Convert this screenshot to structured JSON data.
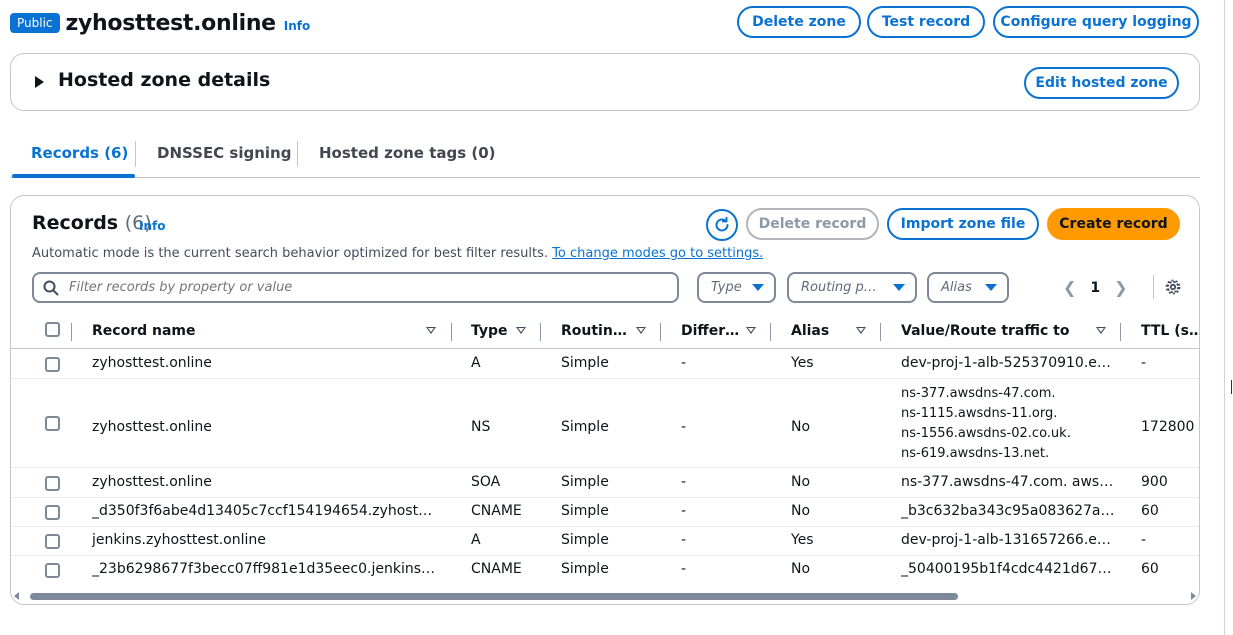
{
  "header": {
    "badge": "Public",
    "zone_name": "zyhosttest.online",
    "info": "Info",
    "buttons": {
      "delete_zone": "Delete zone",
      "test_record": "Test record",
      "configure_query_logging": "Configure query logging"
    }
  },
  "details": {
    "title": "Hosted zone details",
    "edit_button": "Edit hosted zone"
  },
  "tabs": [
    {
      "label": "Records (6)",
      "active": true
    },
    {
      "label": "DNSSEC signing",
      "active": false
    },
    {
      "label": "Hosted zone tags (0)",
      "active": false
    }
  ],
  "records": {
    "title": "Records",
    "count": "(6)",
    "info": "Info",
    "delete_record": "Delete record",
    "import_zone_file": "Import zone file",
    "create_record": "Create record",
    "helper_text": "Automatic mode is the current search behavior optimized for best filter results.",
    "helper_link": "To change modes go to settings.",
    "filter_placeholder": "Filter records by property or value",
    "filters": {
      "type": "Type",
      "routing": "Routing p…",
      "alias": "Alias"
    },
    "page": "1",
    "columns": {
      "record_name": "Record name",
      "type": "Type",
      "routing": "Routin…",
      "differentiator": "Differ…",
      "alias": "Alias",
      "value": "Value/Route traffic to",
      "ttl": "TTL (s…"
    },
    "rows": [
      {
        "name": "zyhosttest.online",
        "type": "A",
        "routing": "Simple",
        "diff": "-",
        "alias": "Yes",
        "value": "dev-proj-1-alb-525370910.e…",
        "ttl": "-"
      },
      {
        "name": "zyhosttest.online",
        "type": "NS",
        "routing": "Simple",
        "diff": "-",
        "alias": "No",
        "values": [
          "ns-377.awsdns-47.com.",
          "ns-1115.awsdns-11.org.",
          "ns-1556.awsdns-02.co.uk.",
          "ns-619.awsdns-13.net."
        ],
        "ttl": "172800"
      },
      {
        "name": "zyhosttest.online",
        "type": "SOA",
        "routing": "Simple",
        "diff": "-",
        "alias": "No",
        "value": "ns-377.awsdns-47.com. awsd…",
        "ttl": "900"
      },
      {
        "name": "_d350f3f6abe4d13405c7ccf154194654.zyhosttest…",
        "type": "CNAME",
        "routing": "Simple",
        "diff": "-",
        "alias": "No",
        "value": "_b3c632ba343c95a083627a…",
        "ttl": "60"
      },
      {
        "name": "jenkins.zyhosttest.online",
        "type": "A",
        "routing": "Simple",
        "diff": "-",
        "alias": "Yes",
        "value": "dev-proj-1-alb-131657266.e…",
        "ttl": "-"
      },
      {
        "name": "_23b6298677f3becc07ff981e1d35eec0.jenkins.zy…",
        "type": "CNAME",
        "routing": "Simple",
        "diff": "-",
        "alias": "No",
        "value": "_50400195b1f4cdc4421d67…",
        "ttl": "60"
      }
    ]
  },
  "colors": {
    "accent": "#0972d3",
    "primary_button": "#ff9900"
  }
}
